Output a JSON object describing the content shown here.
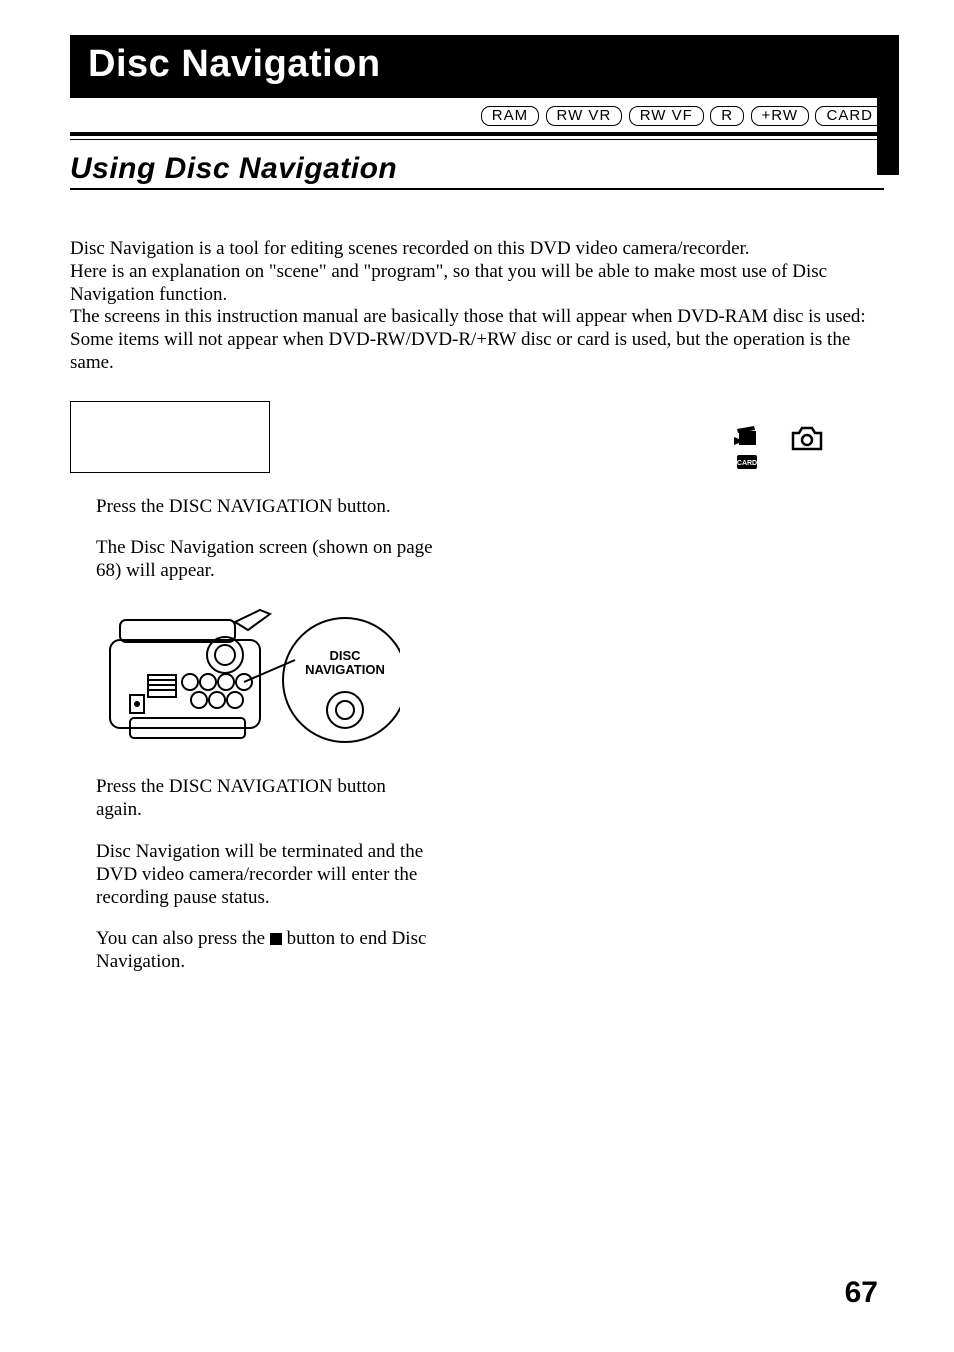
{
  "title_bar": "Disc Navigation",
  "media_badges": [
    "RAM",
    "RW VR",
    "RW VF",
    "R",
    "+RW",
    "CARD"
  ],
  "section_title": "Using Disc Navigation",
  "intro_paragraph": "Disc Navigation is a tool for editing scenes recorded on this DVD video camera/recorder.\nHere is an explanation on \"scene\" and \"program\", so that you will be able to make most use of Disc Navigation function.\nThe screens in this instruction manual are basically those that will appear when DVD-RAM disc is used: Some items will not appear when DVD-RW/DVD-R/+RW disc or card is used, but the operation is the same.",
  "steps": {
    "s1_line1": "Press the DISC NAVIGATION button.",
    "s1_line2": "The Disc Navigation screen (shown on page 68) will appear.",
    "s2_line1": "Press the DISC NAVIGATION button again.",
    "s2_line2": "Disc Navigation will be terminated and the DVD video camera/recorder will enter the recording pause status.",
    "s2_line3_pre": "You can also press the ",
    "s2_line3_post": " button to end Disc Navigation."
  },
  "illustration_label_top": "DISC",
  "illustration_label_bottom": "NAVIGATION",
  "page_number": "67"
}
